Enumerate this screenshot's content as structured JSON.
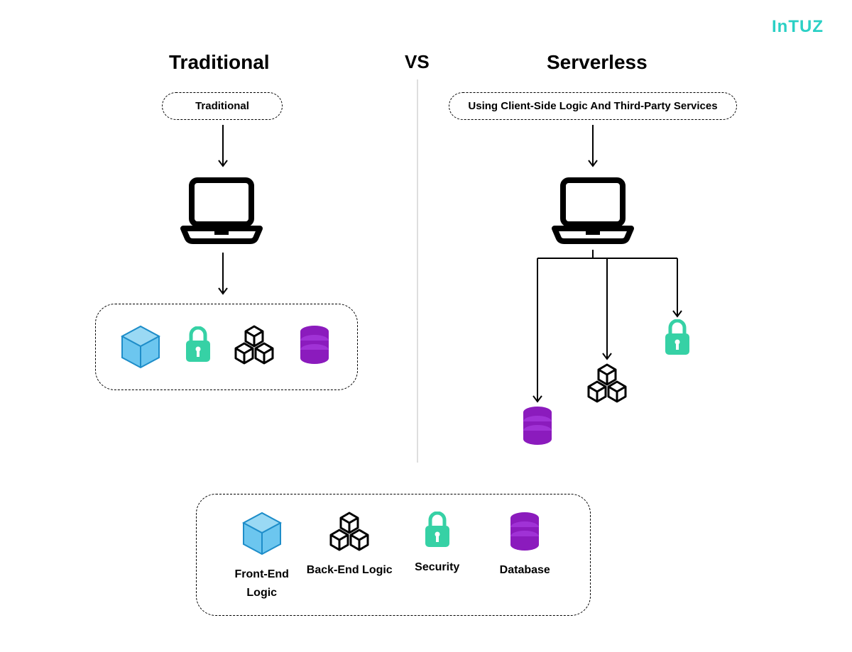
{
  "brand": "InTUZ",
  "headings": {
    "left": "Traditional",
    "vs": "VS",
    "right": "Serverless"
  },
  "pills": {
    "traditional": "Traditional",
    "serverless": "Using Client-Side Logic And Third-Party Services"
  },
  "legend": {
    "frontend": "Front-End Logic",
    "backend": "Back-End Logic",
    "security": "Security",
    "database": "Database"
  },
  "colors": {
    "cube": "#45b3e7",
    "lock": "#36d1a5",
    "modules": "#000000",
    "db": "#8b1bbd",
    "brand": "#2bd0c5"
  }
}
